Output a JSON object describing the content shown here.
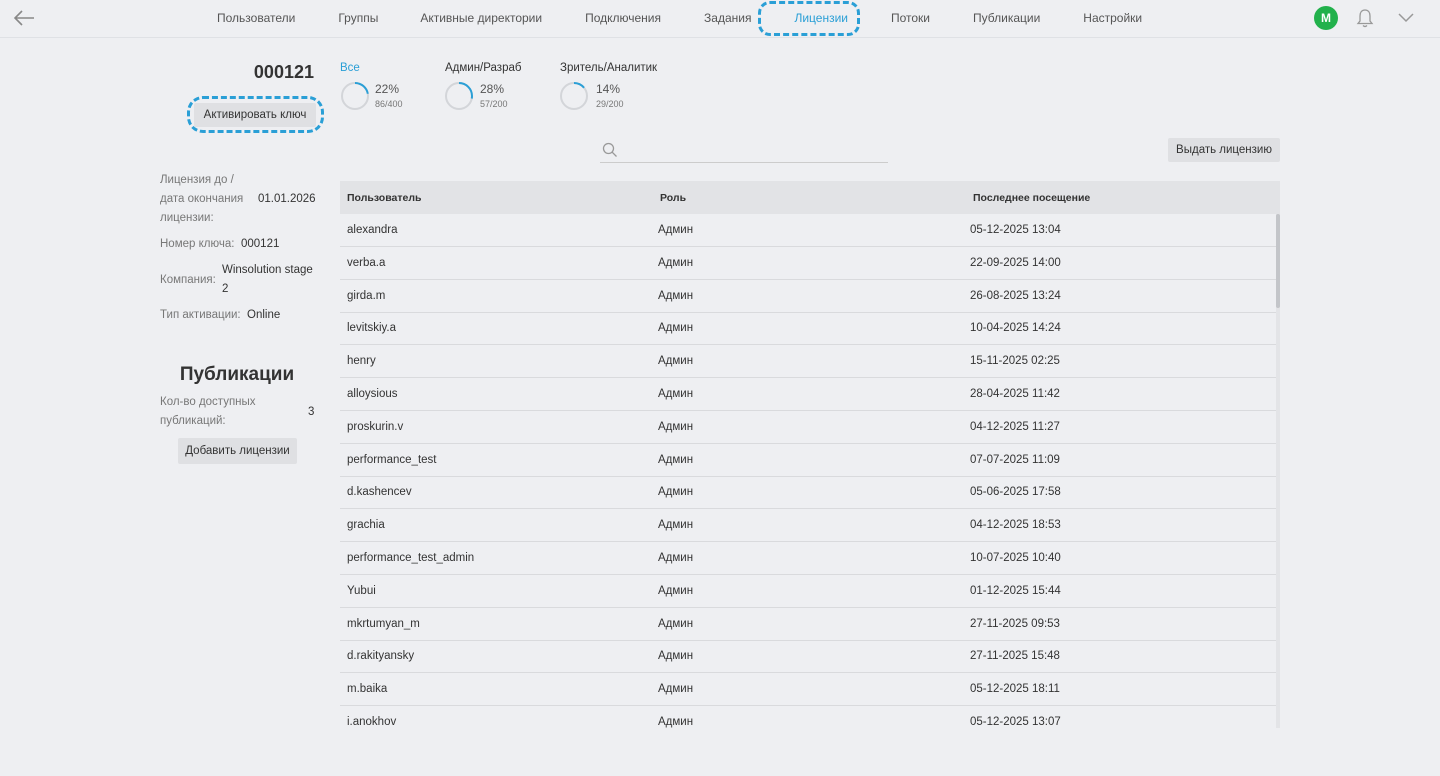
{
  "nav": {
    "items": [
      {
        "label": "Пользователи",
        "active": false
      },
      {
        "label": "Группы",
        "active": false
      },
      {
        "label": "Активные директории",
        "active": false
      },
      {
        "label": "Подключения",
        "active": false
      },
      {
        "label": "Задания",
        "active": false
      },
      {
        "label": "Лицензии",
        "active": true
      },
      {
        "label": "Потоки",
        "active": false
      },
      {
        "label": "Публикации",
        "active": false
      },
      {
        "label": "Настройки",
        "active": false
      }
    ],
    "avatar_letter": "M",
    "icons": {
      "back": "arrow-left-icon",
      "bell": "bell-icon",
      "menu": "chevron-down-icon"
    }
  },
  "license": {
    "key_number": "000121",
    "activate_label": "Активировать ключ",
    "fields": {
      "expires_label_1": "Лицензия до /",
      "expires_label_2": "дата окончания",
      "expires_label_3": "лицензии:",
      "expires_value": "01.01.2026",
      "key_label": "Номер ключа:",
      "key_value": "000121",
      "company_label": "Компания:",
      "company_value_1": "Winsolution stage",
      "company_value_2": "2",
      "activation_label": "Тип активации:",
      "activation_value": "Online"
    }
  },
  "publications": {
    "title": "Публикации",
    "count_label_1": "Кол-во доступных",
    "count_label_2": "публикаций:",
    "count_value": "3",
    "add_label": "Добавить лицензии"
  },
  "stats": [
    {
      "title": "Все",
      "percent_label": "22%",
      "ratio": "86/400",
      "fraction": 0.22,
      "active": true
    },
    {
      "title": "Админ/Разраб",
      "percent_label": "28%",
      "ratio": "57/200",
      "fraction": 0.28,
      "active": false
    },
    {
      "title": "Зритель/Аналитик",
      "percent_label": "14%",
      "ratio": "29/200",
      "fraction": 0.14,
      "active": false
    }
  ],
  "search": {
    "placeholder": "",
    "value": ""
  },
  "issue_label": "Выдать лицензию",
  "table": {
    "headers": {
      "user": "Пользователь",
      "role": "Роль",
      "last_seen": "Последнее посещение"
    },
    "rows": [
      {
        "user": "alexandra",
        "role": "Админ",
        "last_seen": "05-12-2025 13:04"
      },
      {
        "user": "verba.a",
        "role": "Админ",
        "last_seen": "22-09-2025 14:00"
      },
      {
        "user": "girda.m",
        "role": "Админ",
        "last_seen": "26-08-2025 13:24"
      },
      {
        "user": "levitskiy.a",
        "role": "Админ",
        "last_seen": "10-04-2025 14:24"
      },
      {
        "user": "henry",
        "role": "Админ",
        "last_seen": "15-11-2025 02:25"
      },
      {
        "user": "alloysious",
        "role": "Админ",
        "last_seen": "28-04-2025 11:42"
      },
      {
        "user": "proskurin.v",
        "role": "Админ",
        "last_seen": "04-12-2025 11:27"
      },
      {
        "user": "performance_test",
        "role": "Админ",
        "last_seen": "07-07-2025 11:09"
      },
      {
        "user": "d.kashencev",
        "role": "Админ",
        "last_seen": "05-06-2025 17:58"
      },
      {
        "user": "grachia",
        "role": "Админ",
        "last_seen": "04-12-2025 18:53"
      },
      {
        "user": "performance_test_admin",
        "role": "Админ",
        "last_seen": "10-07-2025 10:40"
      },
      {
        "user": "Yubui",
        "role": "Админ",
        "last_seen": "01-12-2025 15:44"
      },
      {
        "user": "mkrtumyan_m",
        "role": "Админ",
        "last_seen": "27-11-2025 09:53"
      },
      {
        "user": "d.rakityansky",
        "role": "Админ",
        "last_seen": "27-11-2025 15:48"
      },
      {
        "user": "m.baika",
        "role": "Админ",
        "last_seen": "05-12-2025 18:11"
      },
      {
        "user": "i.anokhov",
        "role": "Админ",
        "last_seen": "05-12-2025 13:07"
      }
    ]
  },
  "colors": {
    "accent": "#2a9fd6",
    "avatar": "#22b14c",
    "background": "#eeeff2",
    "ring_track": "#d3d5d9"
  }
}
